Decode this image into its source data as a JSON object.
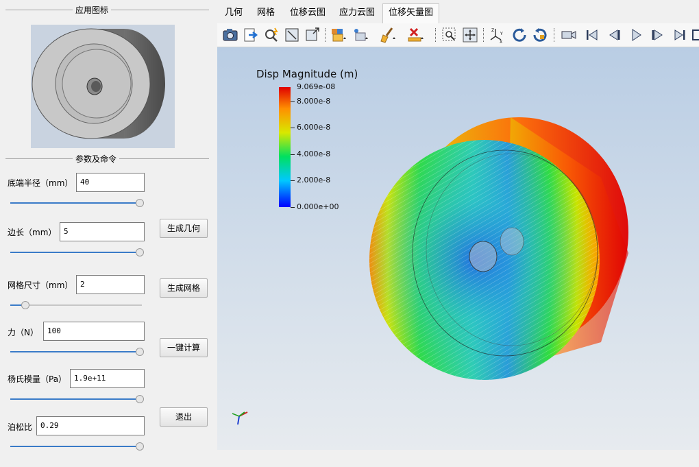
{
  "left_panel": {
    "icon_section_title": "应用图标",
    "params_section_title": "参数及命令",
    "params": [
      {
        "label": "底端半径（mm）",
        "value": "40",
        "slider": 1.0
      },
      {
        "label": "边长（mm）",
        "value": "5",
        "slider": 1.0
      },
      {
        "label": "网格尺寸（mm）",
        "value": "2",
        "slider": 0.1
      },
      {
        "label": "力（N）",
        "value": "100",
        "slider": 1.0
      },
      {
        "label": "杨氏模量（Pa）",
        "value": "1.9e+11",
        "slider": 1.0
      },
      {
        "label": "泊松比",
        "value": "0.29",
        "slider": 1.0
      }
    ],
    "buttons": {
      "gen_geometry": "生成几何",
      "gen_mesh": "生成网格",
      "compute": "一键计算",
      "exit": "退出"
    }
  },
  "tabs": [
    {
      "label": "几何",
      "active": false
    },
    {
      "label": "网格",
      "active": false
    },
    {
      "label": "位移云图",
      "active": false
    },
    {
      "label": "应力云图",
      "active": false
    },
    {
      "label": "位移矢量图",
      "active": true
    }
  ],
  "toolbar_icons": [
    "screenshot-icon",
    "export-icon",
    "zoom-probe-icon",
    "reset-camera-icon",
    "zoom-to-box-icon",
    "select-cells-icon",
    "select-points-icon",
    "clear-selection-icon",
    "delete-icon",
    "zoom-to-selection-icon",
    "pick-center-icon",
    "axes-orientation-icon",
    "rotate-plus-90-icon",
    "rotate-minus-90-icon",
    "camera-icon",
    "first-frame-icon",
    "previous-frame-icon",
    "play-icon",
    "next-frame-icon",
    "last-frame-icon",
    "loop-icon"
  ],
  "viewport": {
    "legend": {
      "title": "Disp Magnitude (m)",
      "max_label": "9.069e-08",
      "tick_labels": [
        "8.000e-8",
        "6.000e-8",
        "4.000e-8",
        "2.000e-8",
        "0.000e+00"
      ],
      "tick_values": [
        8e-08,
        6e-08,
        4e-08,
        2e-08,
        0
      ],
      "range": [
        0,
        9.069e-08
      ],
      "colormap": [
        "#0000ff",
        "#00c8ff",
        "#00e060",
        "#d8e800",
        "#ff9000",
        "#e00000"
      ]
    }
  }
}
